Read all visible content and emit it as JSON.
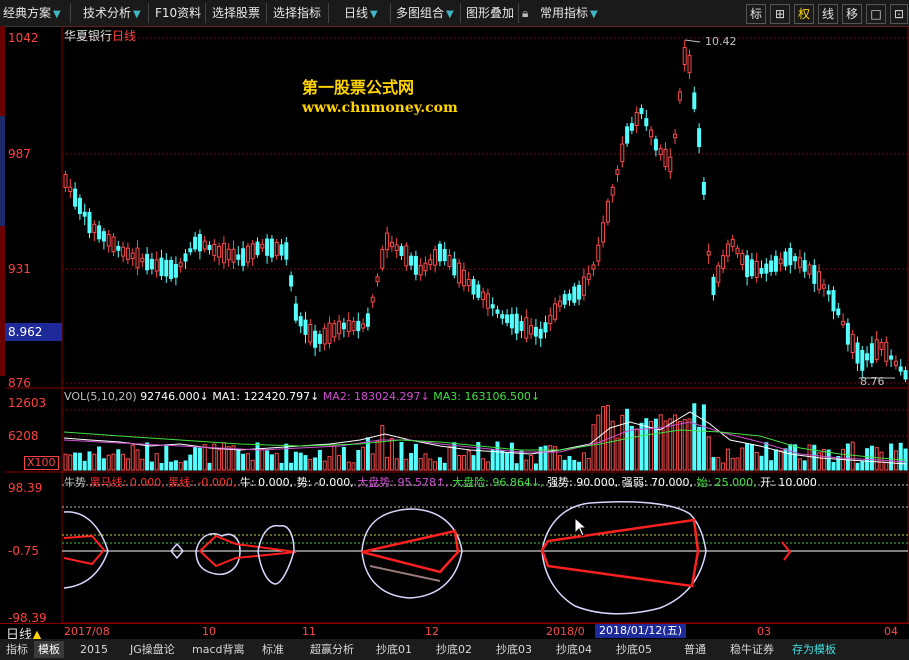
{
  "toolbar": {
    "items": [
      {
        "label": "经典方案",
        "arrow": true
      },
      {
        "label": "技术分析",
        "arrow": true
      },
      {
        "label": "F10资料",
        "arrow": false
      },
      {
        "label": "选择股票",
        "arrow": false
      },
      {
        "label": "选择指标",
        "arrow": false
      },
      {
        "label": "日线",
        "arrow": true
      },
      {
        "label": "多图组合",
        "arrow": true
      },
      {
        "label": "图形叠加",
        "arrow": false
      },
      {
        "label": "常用指标",
        "arrow": true
      }
    ],
    "right_buttons": [
      "标",
      "⊞",
      "权",
      "线",
      "移",
      "□",
      "⊡"
    ]
  },
  "stock": {
    "name": "华夏银行",
    "period": "日线"
  },
  "watermark": {
    "line1": "第一股票公式网",
    "line2": "www.chnmoney.com"
  },
  "price_axis": {
    "labels": [
      "1042",
      "987",
      "931",
      "876"
    ],
    "current": "8.962"
  },
  "price_annotations": {
    "high": "10.42",
    "low": "8.76"
  },
  "volume": {
    "header": [
      {
        "text": "VOL(5,10,20)",
        "color": "#c0c0c0"
      },
      {
        "text": "92746.000↓",
        "color": "#ffffff"
      },
      {
        "text": "MA1: 122420.797↓",
        "color": "#ffffff"
      },
      {
        "text": "MA2: 183024.297↓",
        "color": "#d050d0"
      },
      {
        "text": "MA3: 163106.500↓",
        "color": "#40e040"
      }
    ],
    "axis_labels": [
      "12603",
      "6208"
    ],
    "multiplier": "X100"
  },
  "indicator": {
    "header": [
      {
        "text": "牛势",
        "color": "#c0c0c0"
      },
      {
        "text": "黑马线: 0.000,",
        "color": "#ff3030"
      },
      {
        "text": "黑线: -0.000,",
        "color": "#ff3030"
      },
      {
        "text": "牛: 0.000,",
        "color": "#ffffff"
      },
      {
        "text": "势: -0.000,",
        "color": "#ffffff"
      },
      {
        "text": "大盘势: 95.578↑,",
        "color": "#d050d0"
      },
      {
        "text": "大盘险: 96.864↓,",
        "color": "#40e040"
      },
      {
        "text": "强势: 90.000,",
        "color": "#ffffff"
      },
      {
        "text": "强弱: 70.000,",
        "color": "#ffffff"
      },
      {
        "text": "始: 25.000,",
        "color": "#40e040"
      },
      {
        "text": "开: 10.000",
        "color": "#ffffff"
      }
    ],
    "axis_labels": [
      "98.39",
      "-0.75",
      "-98.39"
    ]
  },
  "date_axis": {
    "labels": [
      "2017/08",
      "10",
      "11",
      "12",
      "2018/0",
      "03",
      "04"
    ],
    "cursor_date": "2018/01/12(五)"
  },
  "bottom_tabs": {
    "period": "日线",
    "items": [
      "指标",
      "模板",
      "2015",
      "JG操盘论",
      "macd背离",
      "标准",
      "超赢分析",
      "抄底01",
      "抄底02",
      "抄底03",
      "抄底04",
      "抄底05",
      "普通",
      "稳牛证券",
      "存为模板"
    ]
  }
}
